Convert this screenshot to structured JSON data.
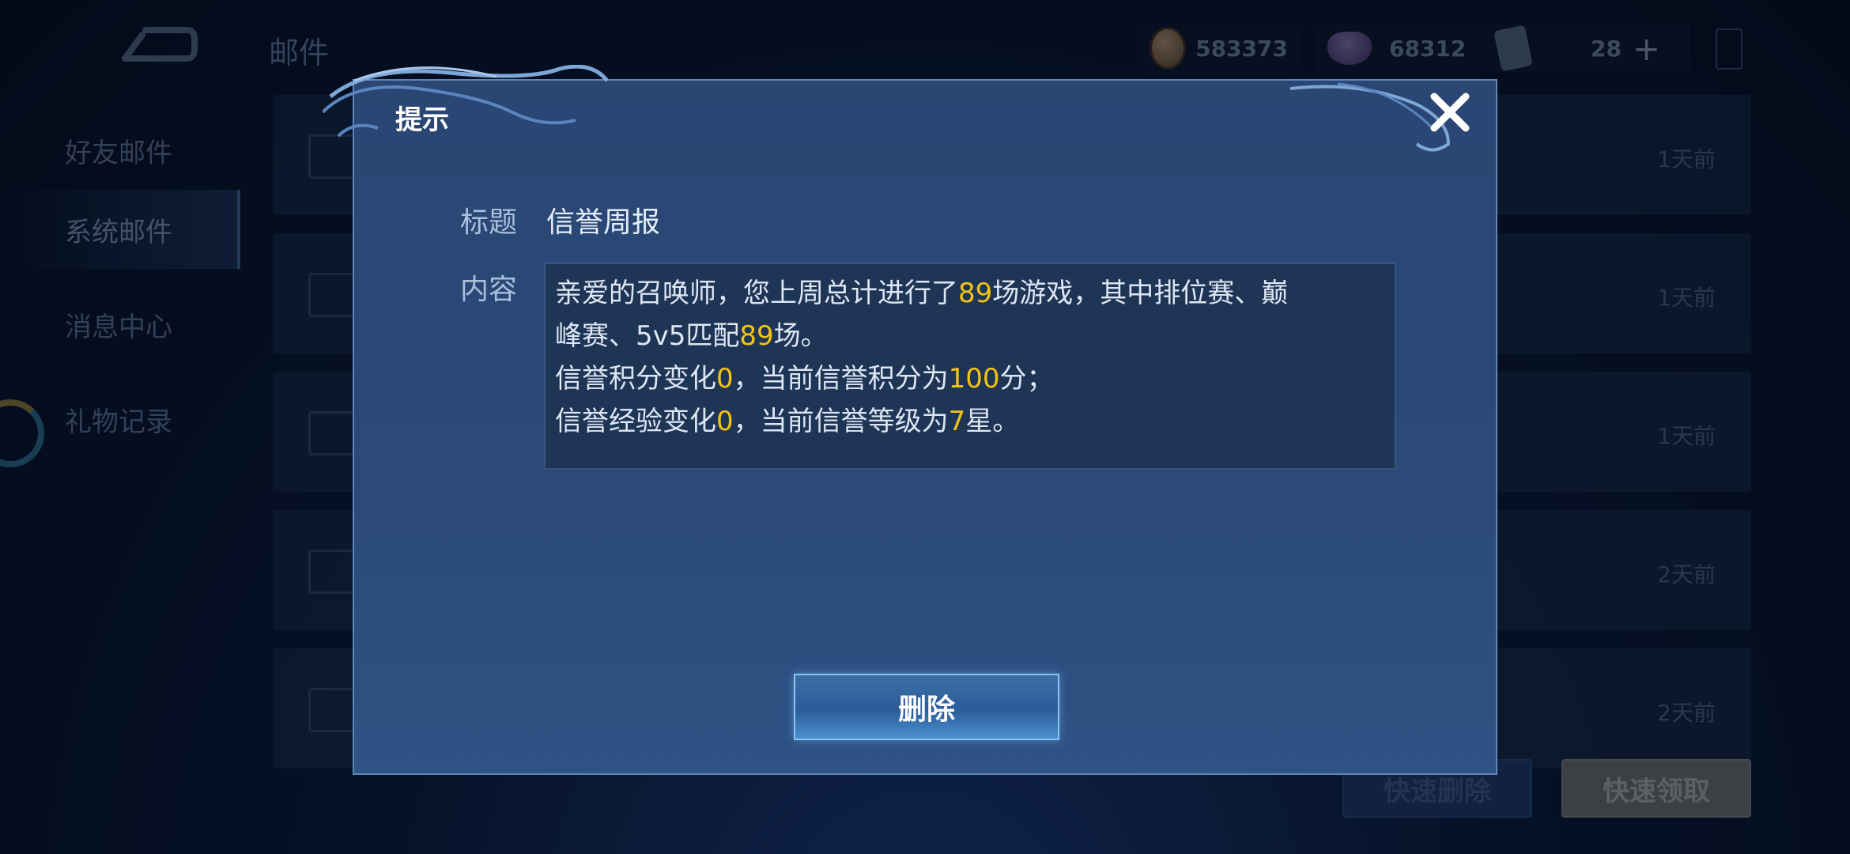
{
  "header": {
    "page_title": "邮件",
    "gold": "583373",
    "gems": "68312",
    "cards": "28",
    "add_symbol": "+"
  },
  "sidebar": {
    "items": [
      {
        "label": "好友邮件",
        "active": false
      },
      {
        "label": "系统邮件",
        "active": true
      },
      {
        "label": "消息中心",
        "active": false
      },
      {
        "label": "礼物记录",
        "active": false
      }
    ]
  },
  "mail_list": {
    "rows": [
      {
        "time": "1天前"
      },
      {
        "time": "1天前"
      },
      {
        "time": "1天前"
      },
      {
        "time": "2天前"
      },
      {
        "time": "2天前"
      }
    ]
  },
  "footer": {
    "quick_delete": "快速删除",
    "quick_claim": "快速领取"
  },
  "dialog": {
    "title": "提示",
    "close_symbol": "✕",
    "subject_label": "标题",
    "subject_value": "信誉周报",
    "content_label": "内容",
    "content_lines": [
      {
        "a": "亲爱的召唤师，您上周总计进行了",
        "b": "89",
        "c": "场游戏，其中排位赛、巅"
      },
      {
        "a": "峰赛、5v5匹配",
        "b": "89",
        "c": "场。"
      },
      {
        "a": "信誉积分变化",
        "b": "0",
        "c": "，当前信誉积分为",
        "d": "100",
        "e": "分；"
      },
      {
        "a": "信誉经验变化",
        "b": "0",
        "c": "，当前信誉等级为",
        "d": "7",
        "e": "星。"
      }
    ],
    "delete_label": "删除"
  },
  "colors": {
    "highlight": "#f2c316",
    "dialog_bg": "#2b4a7a",
    "accent_border": "#8cc3f2"
  }
}
